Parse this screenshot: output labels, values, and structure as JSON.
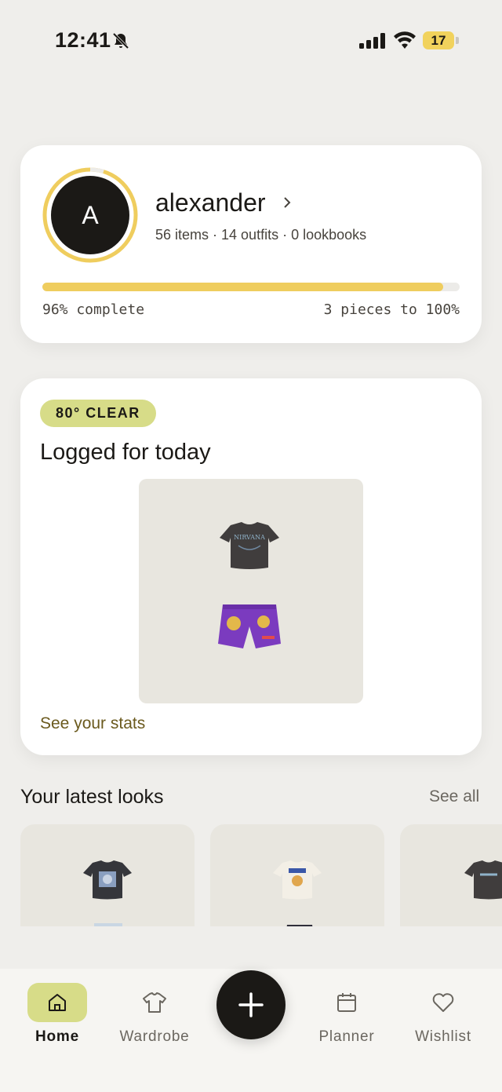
{
  "status_bar": {
    "time": "12:41",
    "battery": "17",
    "icons": [
      "bell-slash-icon",
      "signal-icon",
      "wifi-icon",
      "battery-icon"
    ]
  },
  "profile": {
    "avatar_letter": "A",
    "name": "alexander",
    "stats": "56 items · 14 outfits · 0 lookbooks",
    "progress_fraction": 0.96,
    "progress_left": "96% complete",
    "progress_right": "3 pieces to 100%"
  },
  "today": {
    "weather_badge": "80° CLEAR",
    "title": "Logged for today",
    "items": [
      "shirt-icon",
      "shorts-icon"
    ],
    "stats_link": "See your stats"
  },
  "latest_looks": {
    "title": "Your latest looks",
    "see_all": "See all"
  },
  "tab_bar": {
    "tabs": [
      {
        "label": "Home",
        "icon": "home-icon",
        "active": true
      },
      {
        "label": "Wardrobe",
        "icon": "tshirt-icon",
        "active": false
      },
      {
        "label": "Planner",
        "icon": "calendar-icon",
        "active": false
      },
      {
        "label": "Wishlist",
        "icon": "heart-icon",
        "active": false
      }
    ],
    "add_icon": "plus-icon"
  },
  "colors": {
    "background": "#efeeeb",
    "accent_yellow": "#efcd5e",
    "accent_green": "#d7dc88",
    "link_brown": "#6b5a1e",
    "dark": "#1b1916"
  }
}
